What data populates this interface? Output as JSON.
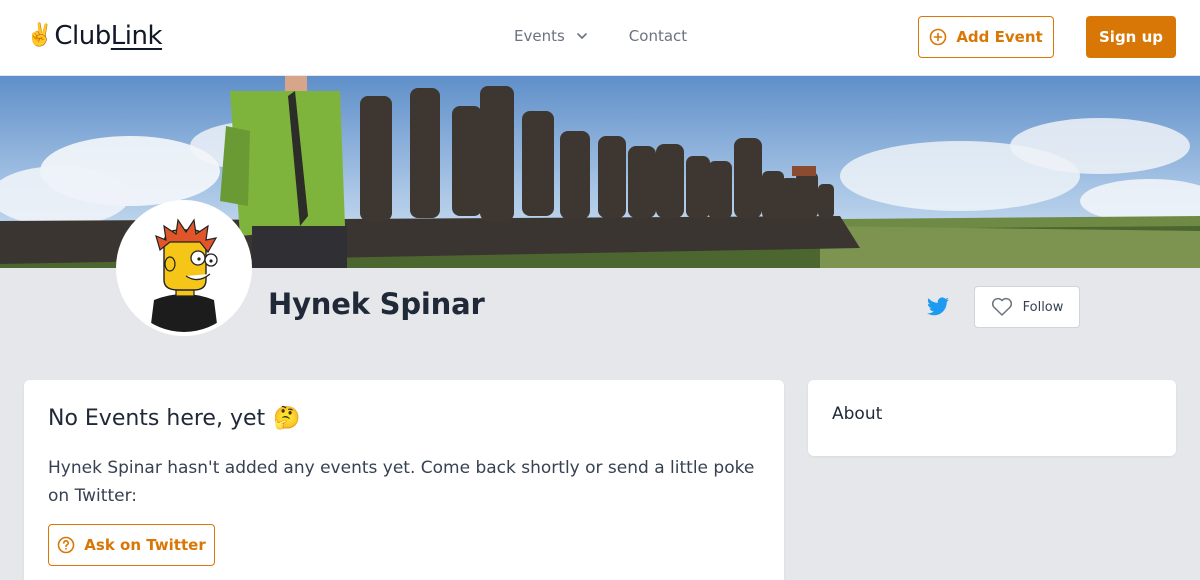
{
  "brand": {
    "hand_emoji": "✌️",
    "name_part1": "Club",
    "name_part2": "Link"
  },
  "nav": {
    "events_label": "Events",
    "contact_label": "Contact"
  },
  "header_actions": {
    "add_event_label": "Add Event",
    "signup_label": "Sign up"
  },
  "profile": {
    "name": "Hynek Spinar",
    "follow_label": "Follow"
  },
  "events_card": {
    "title": "No Events here, yet",
    "title_emoji": "🤔",
    "message": "Hynek Spinar hasn't added any events yet. Come back shortly or send a little poke on Twitter:",
    "ask_label": "Ask on Twitter"
  },
  "about_card": {
    "title": "About"
  },
  "colors": {
    "accent": "#d97706",
    "twitter": "#1d9bf0",
    "page_bg": "#e5e7eb"
  },
  "icons": [
    "chevron-down-icon",
    "plus-circle-icon",
    "twitter-icon",
    "heart-icon",
    "question-circle-icon"
  ]
}
